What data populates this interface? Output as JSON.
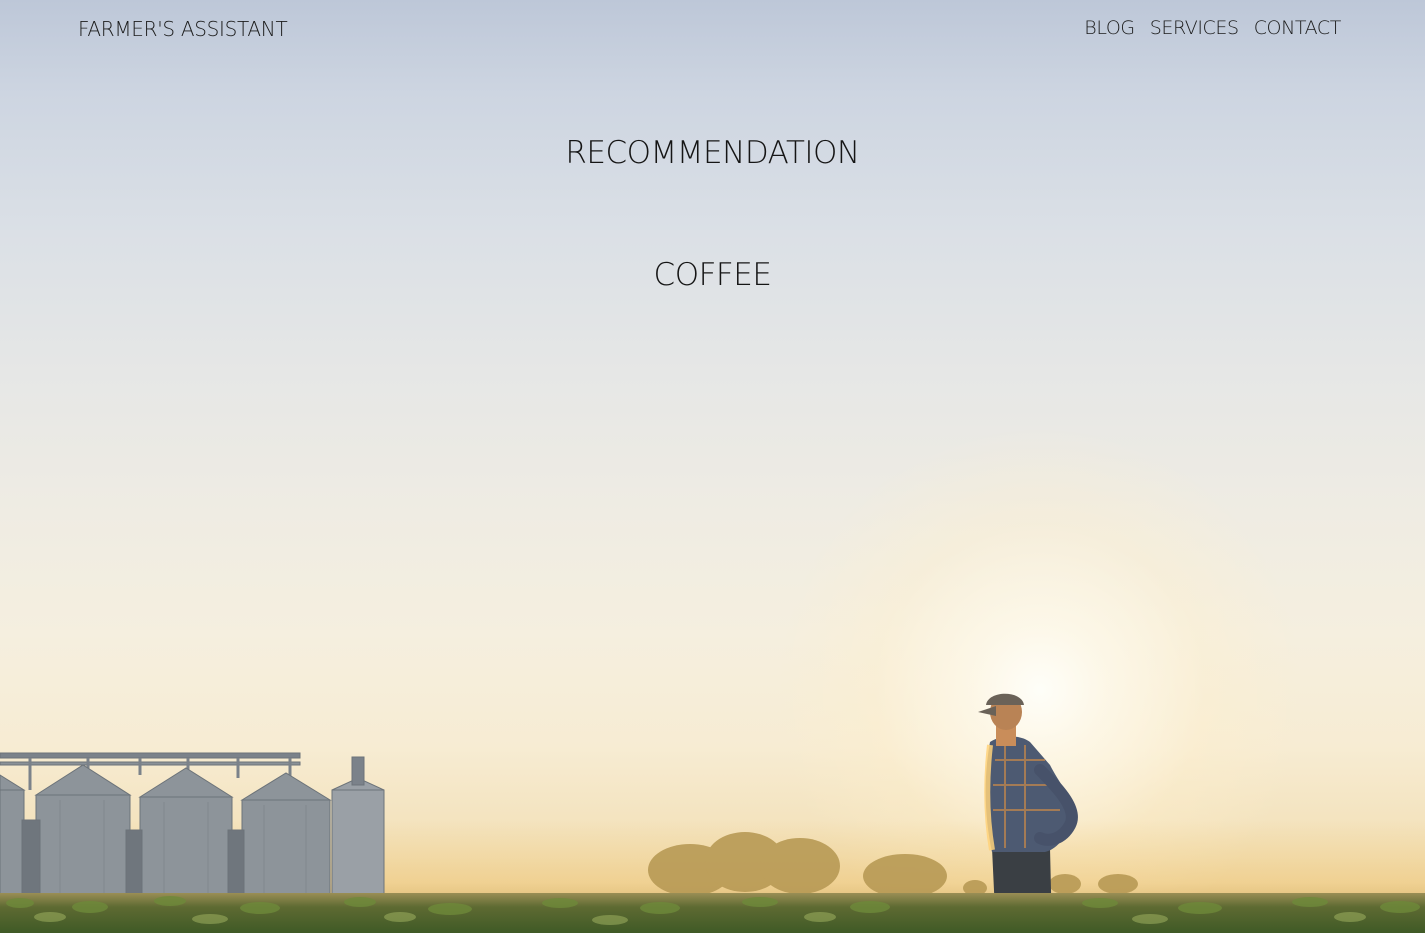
{
  "header": {
    "brand": "FARMER'S ASSISTANT",
    "nav": [
      {
        "label": "BLOG"
      },
      {
        "label": "SERVICES"
      },
      {
        "label": "CONTACT"
      }
    ]
  },
  "main": {
    "title": "RECOMMENDATION",
    "crop": "COFFEE"
  },
  "colors": {
    "text": "#151515",
    "sky_top": "#bdc7d8",
    "sky_bottom": "#f2dfb5",
    "field": "#3f5a26"
  }
}
